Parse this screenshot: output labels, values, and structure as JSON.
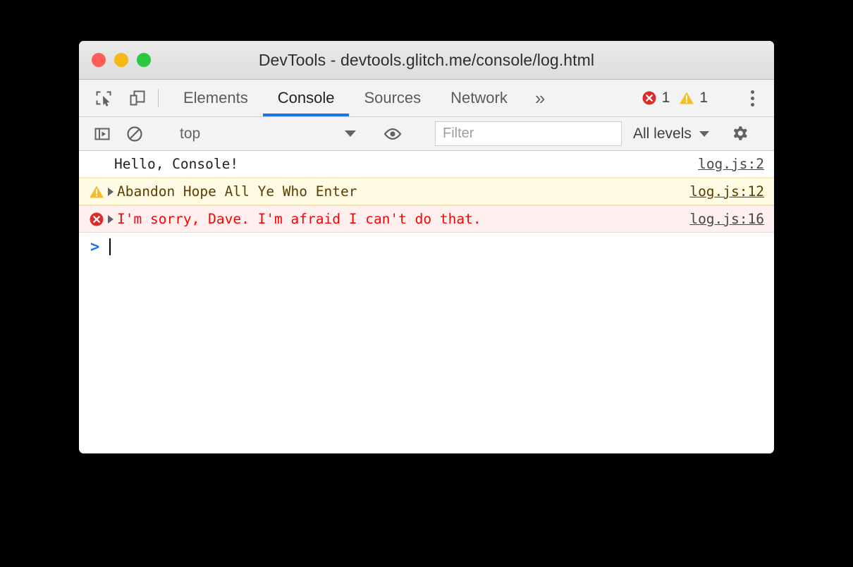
{
  "window": {
    "title": "DevTools - devtools.glitch.me/console/log.html",
    "traffic_lights": [
      {
        "name": "close",
        "color": "#ff5f56"
      },
      {
        "name": "minimize",
        "color": "#f5b816"
      },
      {
        "name": "zoom",
        "color": "#2ac940"
      }
    ]
  },
  "tabbar": {
    "inspect_icon": "inspect-element-icon",
    "device_icon": "device-toolbar-icon",
    "tabs": [
      {
        "label": "Elements",
        "active": false
      },
      {
        "label": "Console",
        "active": true
      },
      {
        "label": "Sources",
        "active": false
      },
      {
        "label": "Network",
        "active": false
      }
    ],
    "more_tabs_label": "»",
    "error_count": "1",
    "warning_count": "1",
    "menu_icon": "kebab-menu-icon",
    "accent_color": "#1a73e8"
  },
  "console_toolbar": {
    "sidebar_toggle_icon": "console-sidebar-icon",
    "clear_icon": "clear-console-icon",
    "context": {
      "value": "top",
      "caret": "▼"
    },
    "eye_icon": "live-expression-eye-icon",
    "filter": {
      "value": "",
      "placeholder": "Filter"
    },
    "levels": {
      "label": "All levels",
      "caret": "▼"
    },
    "settings_icon": "gear-icon"
  },
  "console_messages": [
    {
      "level": "log",
      "icon": "",
      "expandable": false,
      "text": "Hello, Console!",
      "source": "log.js:2",
      "bg": "#ffffff",
      "fg": "#202124"
    },
    {
      "level": "warning",
      "icon": "warning-triangle-icon",
      "expandable": true,
      "text": "Abandon Hope All Ye Who Enter",
      "source": "log.js:12",
      "bg": "#fffbe5",
      "fg": "#5c3c00"
    },
    {
      "level": "error",
      "icon": "error-circle-icon",
      "expandable": true,
      "text": "I'm sorry, Dave. I'm afraid I can't do that.",
      "source": "log.js:16",
      "bg": "#fff0f0",
      "fg": "#ff0000"
    }
  ],
  "prompt": {
    "chevron": ">",
    "value": ""
  }
}
